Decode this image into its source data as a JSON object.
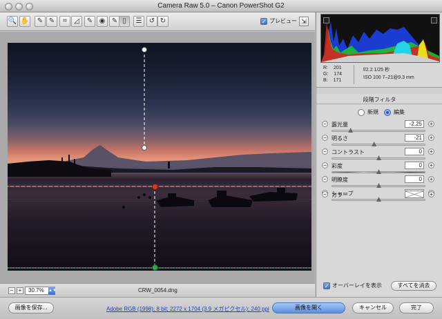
{
  "window": {
    "title": "Camera Raw 5.0  –  Canon PowerShot G2"
  },
  "toolbar": {
    "tools": [
      {
        "name": "zoom-tool",
        "glyph": "🔍"
      },
      {
        "name": "hand-tool",
        "glyph": "✋"
      },
      {
        "name": "white-balance-tool",
        "glyph": "✎"
      },
      {
        "name": "color-sampler-tool",
        "glyph": "✎"
      },
      {
        "name": "crop-tool",
        "glyph": "⌗"
      },
      {
        "name": "straighten-tool",
        "glyph": "◿"
      },
      {
        "name": "spot-removal-tool",
        "glyph": "✎"
      },
      {
        "name": "red-eye-tool",
        "glyph": "◉"
      },
      {
        "name": "adjustment-brush-tool",
        "glyph": "✎"
      },
      {
        "name": "graduated-filter-tool",
        "glyph": "▯"
      },
      {
        "name": "preferences-tool",
        "glyph": "☰"
      },
      {
        "name": "rotate-left-tool",
        "glyph": "↺"
      },
      {
        "name": "rotate-right-tool",
        "glyph": "↻"
      }
    ],
    "preview_label": "プレビュー",
    "preview_checked": true
  },
  "readout": {
    "r_label": "R:",
    "r_value": "201",
    "g_label": "G:",
    "g_value": "174",
    "b_label": "B:",
    "b_value": "171",
    "aperture_shutter": "f/2.2    1/25 秒",
    "iso_lens": "ISO 100   7–21@9.3 mm"
  },
  "panel": {
    "title": "段階フィルタ",
    "mode_new": "新規",
    "mode_edit": "編集",
    "sliders": [
      {
        "label": "露光量",
        "value": "-2.25",
        "thumb": 0.2,
        "track": "plain"
      },
      {
        "label": "明るさ",
        "value": "-21",
        "thumb": 0.45,
        "track": "plain"
      },
      {
        "label": "コントラスト",
        "value": "0",
        "thumb": 0.5,
        "track": "plain"
      },
      {
        "label": "彩度",
        "value": "0",
        "thumb": 0.5,
        "track": "rainbow"
      },
      {
        "label": "明瞭度",
        "value": "0",
        "thumb": 0.5,
        "track": "plain"
      },
      {
        "label": "シャープ",
        "value": "0",
        "thumb": 0.5,
        "track": "plain"
      }
    ],
    "color_label": "カラー",
    "overlay_label": "オーバーレイを表示",
    "overlay_checked": true,
    "clear_all": "すべてを消去"
  },
  "canvas": {
    "zoom": "30.7%",
    "filename": "CRW_0054.dng"
  },
  "footer": {
    "save_label": "画像を保存...",
    "workflow_info": "Adobe RGB (1998); 8 bit; 2272 x 1704 (3.9 メガピクセル); 240 ppi",
    "open_label": "画像を開く",
    "cancel_label": "キャンセル",
    "done_label": "完了"
  },
  "colors": {
    "accent": "#5b8fe2",
    "filter_start_pin": "#d23a2a",
    "filter_end_pin": "#2fa84a"
  }
}
